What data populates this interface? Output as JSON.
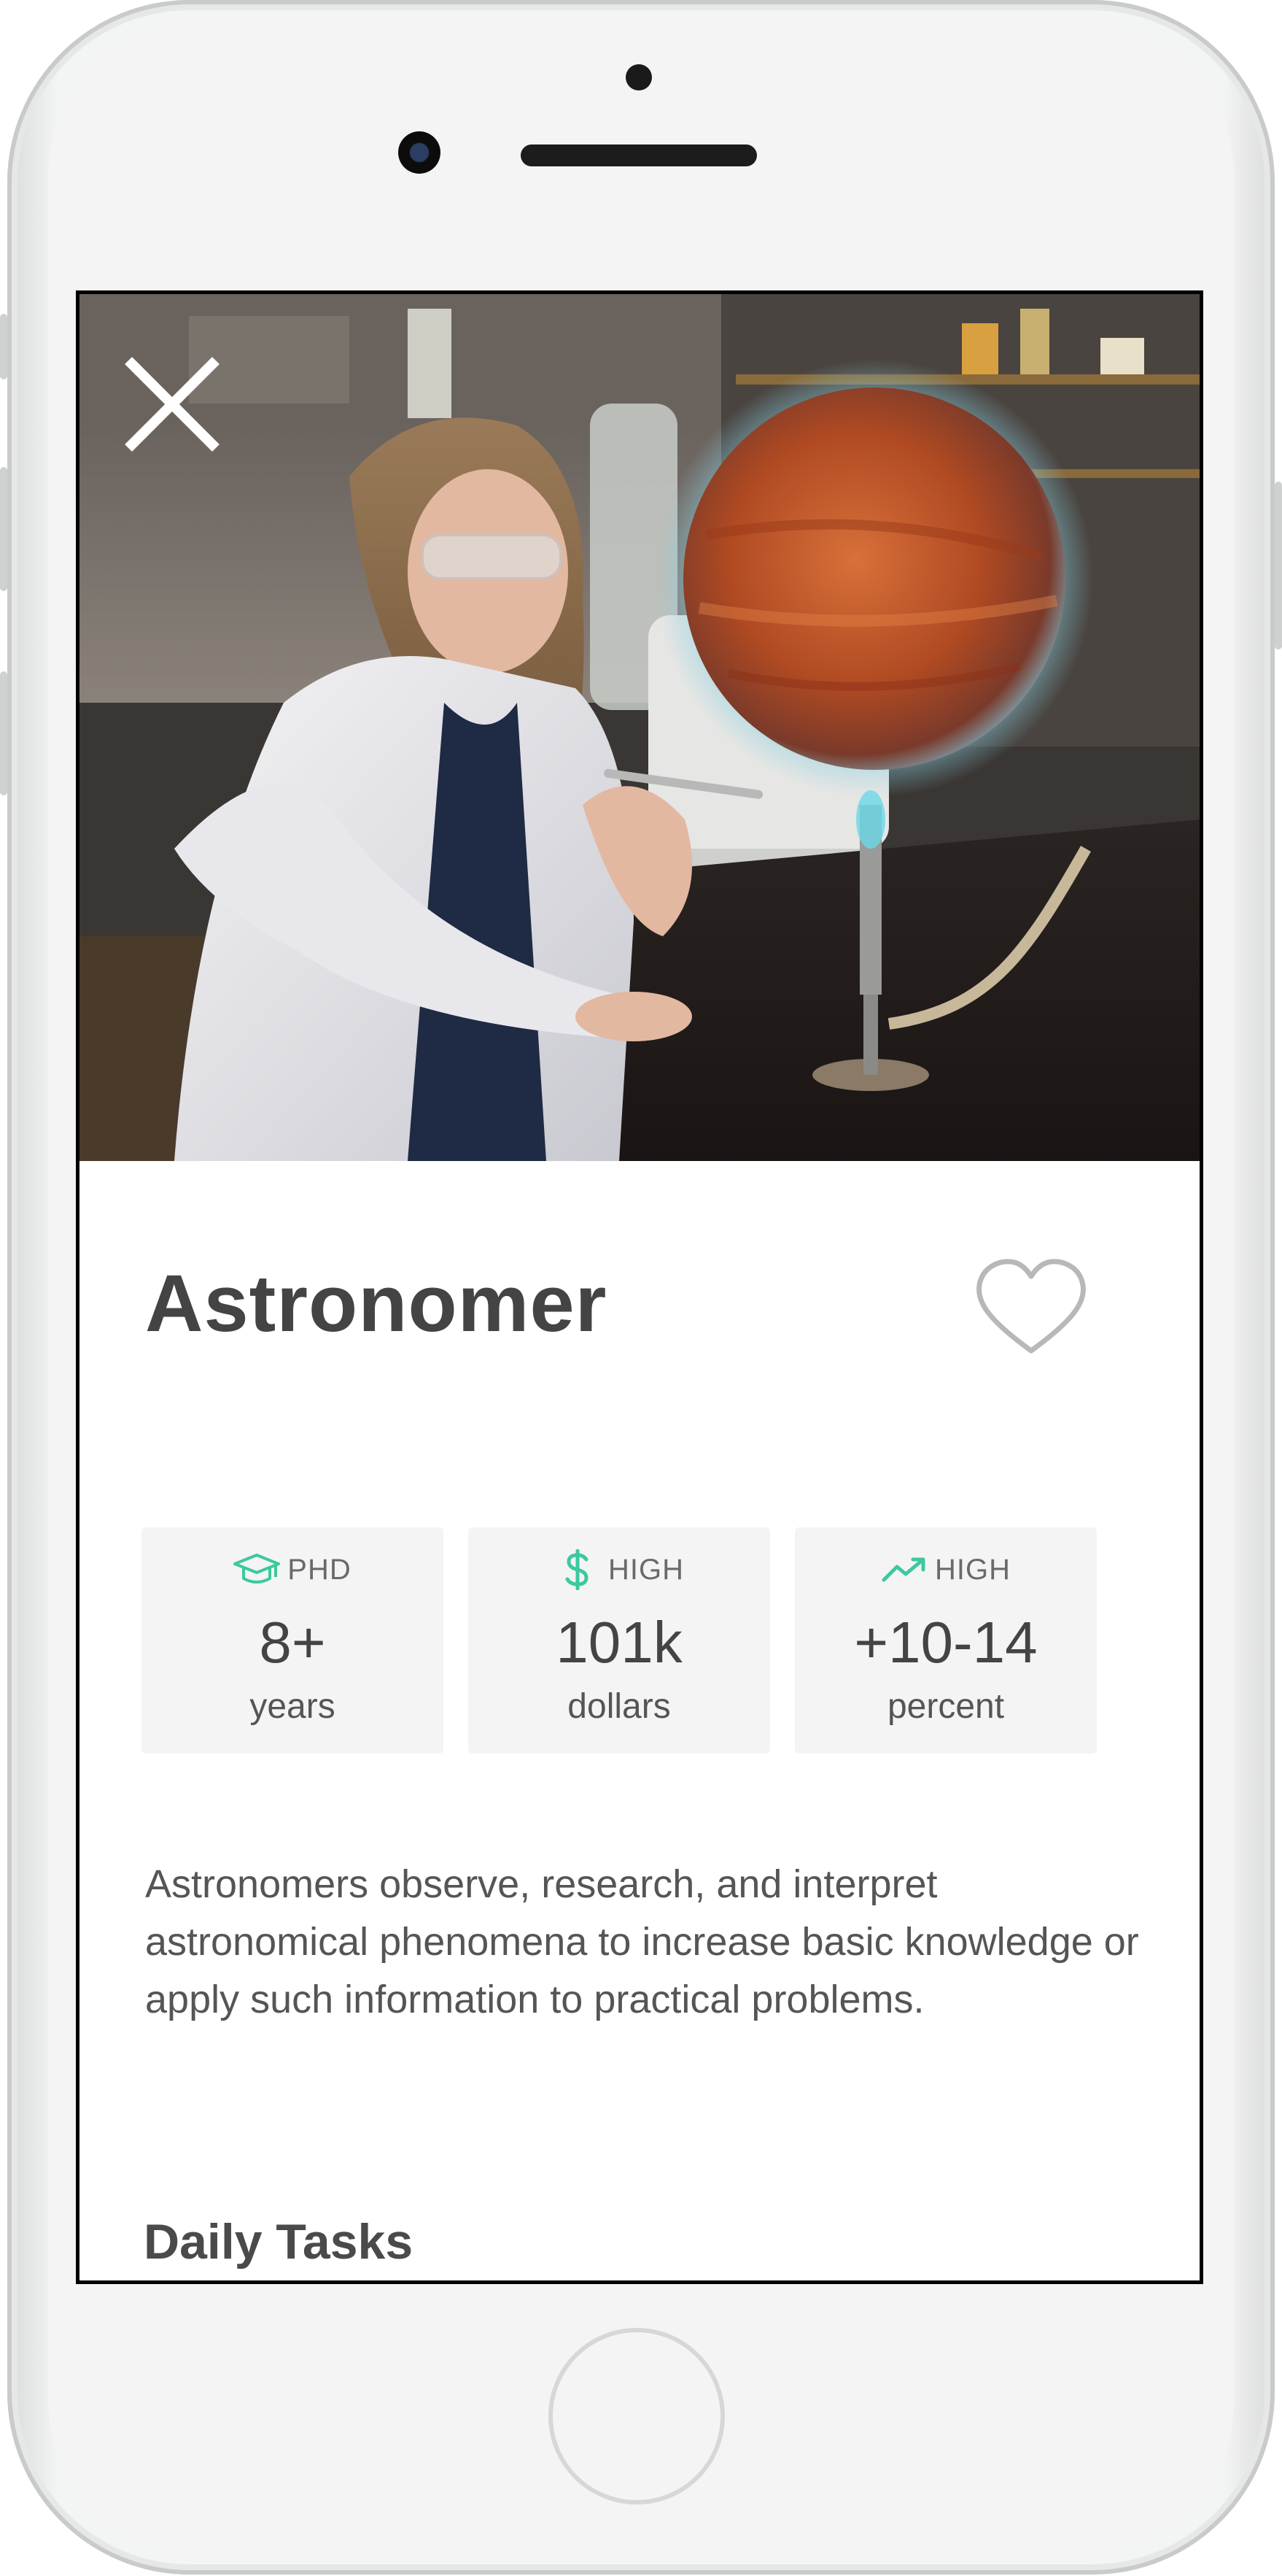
{
  "device": {
    "model": "iPhone-style frame"
  },
  "hero": {
    "image": "scientist in lab with glowing orange planet over bunsen burner",
    "close_icon": "close-icon"
  },
  "career": {
    "title": "Astronomer",
    "favorite_icon": "heart-outline-icon",
    "description": "Astronomers observe, research, and interpret astronomical phenomena to increase basic knowledge or apply such information to practical problems."
  },
  "stats": [
    {
      "icon": "graduation-cap-icon",
      "label": "PHD",
      "value": "8+",
      "unit": "years"
    },
    {
      "icon": "dollar-icon",
      "label": "HIGH",
      "value": "101k",
      "unit": "dollars"
    },
    {
      "icon": "trending-up-icon",
      "label": "HIGH",
      "value": "+10-14",
      "unit": "percent"
    }
  ],
  "sections": {
    "daily_tasks_title": "Daily Tasks"
  },
  "colors": {
    "accent": "#3cc8a0",
    "title_text": "#444444",
    "body_text": "#555555",
    "card_bg": "#f4f4f4"
  }
}
